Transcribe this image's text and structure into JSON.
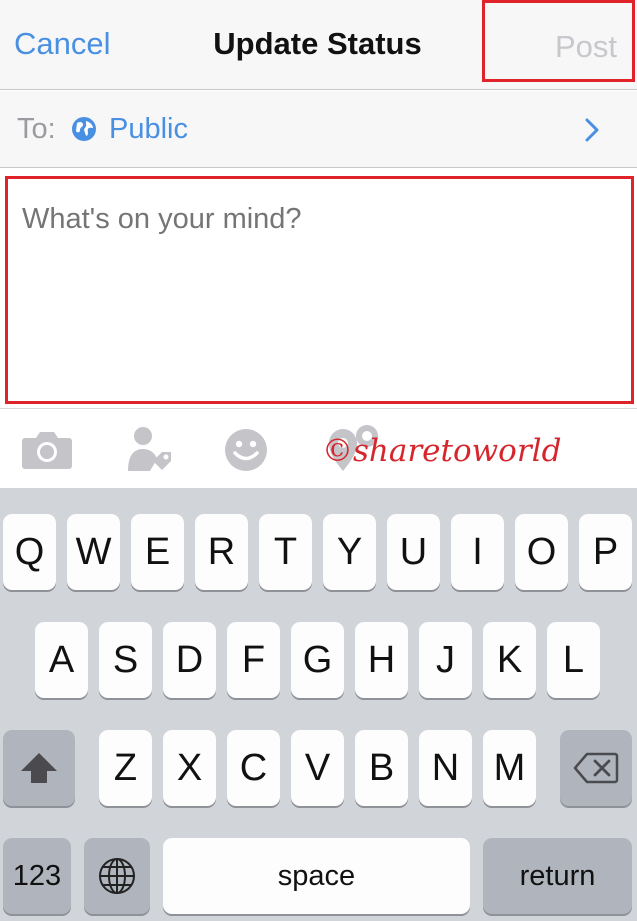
{
  "navbar": {
    "cancel_label": "Cancel",
    "title": "Update Status",
    "post_label": "Post"
  },
  "audience": {
    "to_label": "To:",
    "value": "Public",
    "icon": "globe-icon"
  },
  "composer": {
    "placeholder": "What's on your mind?"
  },
  "attachments": {
    "icons": [
      "camera-icon",
      "tag-person-icon",
      "emoji-icon",
      "location-icon"
    ],
    "watermark": "©sharetoworld"
  },
  "keyboard": {
    "row1": [
      "Q",
      "W",
      "E",
      "R",
      "T",
      "Y",
      "U",
      "I",
      "O",
      "P"
    ],
    "row2": [
      "A",
      "S",
      "D",
      "F",
      "G",
      "H",
      "J",
      "K",
      "L"
    ],
    "row3": [
      "Z",
      "X",
      "C",
      "V",
      "B",
      "N",
      "M"
    ],
    "shift_icon": "shift-icon",
    "delete_icon": "backspace-icon",
    "numbers_label": "123",
    "globe_icon": "globe-icon",
    "space_label": "space",
    "return_label": "return"
  },
  "colors": {
    "accent": "#4a90e2",
    "highlight": "#e0222a",
    "keyboard_bg": "#d1d4d9"
  }
}
